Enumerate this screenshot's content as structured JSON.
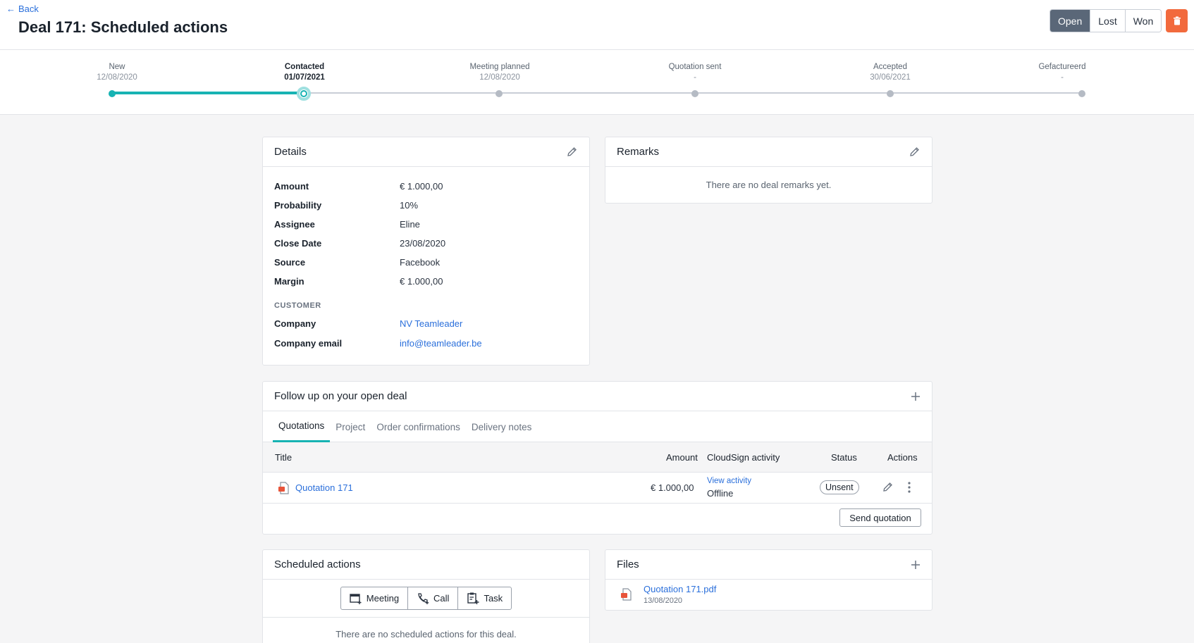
{
  "header": {
    "back_label": "Back",
    "title": "Deal 171: Scheduled actions",
    "status_options": [
      "Open",
      "Lost",
      "Won"
    ]
  },
  "pipeline": {
    "stages": [
      {
        "name": "New",
        "date": "12/08/2020"
      },
      {
        "name": "Contacted",
        "date": "01/07/2021"
      },
      {
        "name": "Meeting planned",
        "date": "12/08/2020"
      },
      {
        "name": "Quotation sent",
        "date": "-"
      },
      {
        "name": "Accepted",
        "date": "30/06/2021"
      },
      {
        "name": "Gefactureerd",
        "date": "-"
      }
    ],
    "current_stage": "Contacted"
  },
  "details": {
    "title": "Details",
    "rows": [
      {
        "label": "Amount",
        "value": "€ 1.000,00"
      },
      {
        "label": "Probability",
        "value": "10%"
      },
      {
        "label": "Assignee",
        "value": "Eline"
      },
      {
        "label": "Close Date",
        "value": "23/08/2020"
      },
      {
        "label": "Source",
        "value": "Facebook"
      },
      {
        "label": "Margin",
        "value": "€ 1.000,00"
      }
    ],
    "customer_heading": "CUSTOMER",
    "customer": [
      {
        "label": "Company",
        "value": "NV Teamleader"
      },
      {
        "label": "Company email",
        "value": "info@teamleader.be"
      }
    ]
  },
  "remarks": {
    "title": "Remarks",
    "empty": "There are no deal remarks yet."
  },
  "followup": {
    "title": "Follow up on your open deal",
    "tabs": [
      "Quotations",
      "Project",
      "Order confirmations",
      "Delivery notes"
    ],
    "columns": {
      "title": "Title",
      "amount": "Amount",
      "cloudsign": "CloudSign activity",
      "status": "Status",
      "actions": "Actions"
    },
    "row": {
      "title": "Quotation 171",
      "amount": "€ 1.000,00",
      "cloudsign_link": "View activity",
      "cloudsign_status": "Offline",
      "status": "Unsent"
    },
    "send_button": "Send quotation"
  },
  "scheduled": {
    "title": "Scheduled actions",
    "buttons": [
      "Meeting",
      "Call",
      "Task"
    ],
    "empty": "There are no scheduled actions for this deal."
  },
  "files": {
    "title": "Files",
    "items": [
      {
        "name": "Quotation 171.pdf",
        "date": "13/08/2020"
      }
    ]
  },
  "colors": {
    "accent": "#17b3b3",
    "link": "#2a6fdb",
    "delete": "#f26a3d",
    "selected_status": "#5a6778"
  }
}
